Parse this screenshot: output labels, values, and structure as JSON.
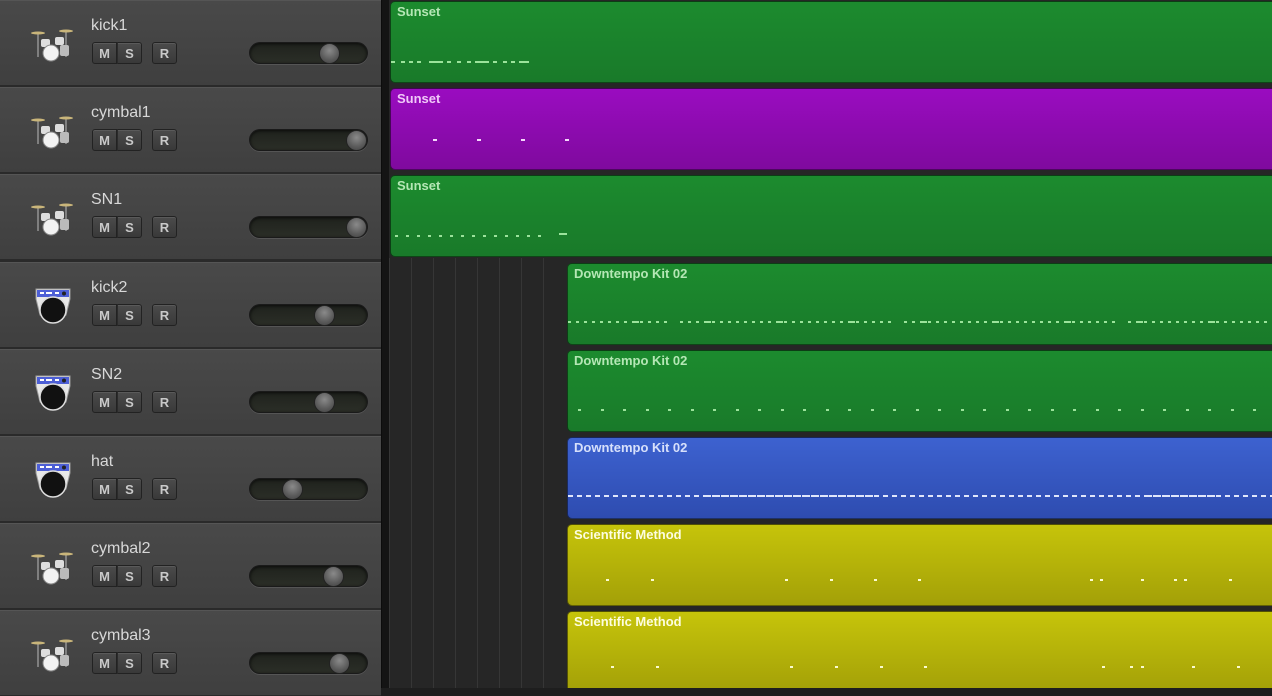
{
  "tracks": [
    {
      "name": "kick1",
      "icon": "drum-kit-icon",
      "mute_label": "M",
      "solo_label": "S",
      "record_label": "R",
      "volume": 0.71
    },
    {
      "name": "cymbal1",
      "icon": "drum-kit-icon",
      "mute_label": "M",
      "solo_label": "S",
      "record_label": "R",
      "volume": 1.0
    },
    {
      "name": "SN1",
      "icon": "drum-kit-icon",
      "mute_label": "M",
      "solo_label": "S",
      "record_label": "R",
      "volume": 1.0
    },
    {
      "name": "kick2",
      "icon": "drum-machine-icon",
      "mute_label": "M",
      "solo_label": "S",
      "record_label": "R",
      "volume": 0.66
    },
    {
      "name": "SN2",
      "icon": "drum-machine-icon",
      "mute_label": "M",
      "solo_label": "S",
      "record_label": "R",
      "volume": 0.66
    },
    {
      "name": "hat",
      "icon": "drum-machine-icon",
      "mute_label": "M",
      "solo_label": "S",
      "record_label": "R",
      "volume": 0.32
    },
    {
      "name": "cymbal2",
      "icon": "drum-kit-icon",
      "mute_label": "M",
      "solo_label": "S",
      "record_label": "R",
      "volume": 0.76
    },
    {
      "name": "cymbal3",
      "icon": "drum-kit-icon",
      "mute_label": "M",
      "solo_label": "S",
      "record_label": "R",
      "volume": 0.82
    }
  ],
  "regions": [
    {
      "title": "Sunset",
      "color": "green",
      "track": 0,
      "start": "early"
    },
    {
      "title": "Sunset",
      "color": "purple",
      "track": 1,
      "start": "early"
    },
    {
      "title": "Sunset",
      "color": "green",
      "track": 2,
      "start": "early"
    },
    {
      "title": "Downtempo Kit 02",
      "color": "green",
      "track": 3,
      "start": "late"
    },
    {
      "title": "Downtempo Kit 02",
      "color": "green",
      "track": 4,
      "start": "late"
    },
    {
      "title": "Downtempo Kit 02",
      "color": "blue",
      "track": 5,
      "start": "late"
    },
    {
      "title": "Scientific Method",
      "color": "yellow",
      "track": 6,
      "start": "late"
    },
    {
      "title": "Scientific Method",
      "color": "yellow",
      "track": 7,
      "start": "late"
    }
  ],
  "colors": {
    "green": "#1c8b2e",
    "purple": "#9a0cc0",
    "blue": "#3d62d0",
    "yellow": "#c6c40a"
  }
}
